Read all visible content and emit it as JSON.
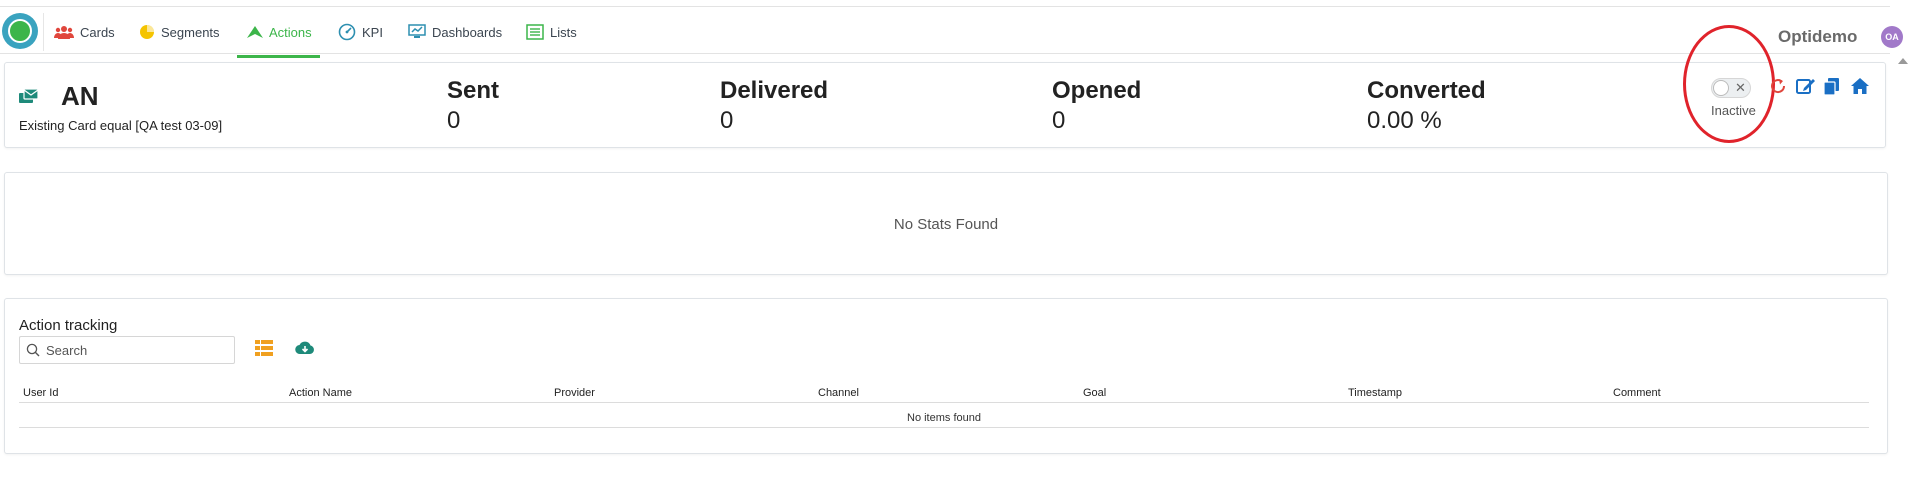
{
  "nav": {
    "items": [
      {
        "label": "Cards",
        "icon": "users-icon",
        "color": "#e0463c"
      },
      {
        "label": "Segments",
        "icon": "pie-chart-icon",
        "color": "#f5c400"
      },
      {
        "label": "Actions",
        "icon": "send-icon",
        "color": "#3cb54a"
      },
      {
        "label": "KPI",
        "icon": "gauge-icon",
        "color": "#2d8fb0"
      },
      {
        "label": "Dashboards",
        "icon": "dashboard-icon",
        "color": "#2d8fb0"
      },
      {
        "label": "Lists",
        "icon": "list-icon",
        "color": "#3cb54a"
      }
    ],
    "active": "Actions",
    "brand": "Optidemo",
    "avatar_initials": "OA"
  },
  "summary": {
    "name": "AN",
    "description": "Existing Card equal [QA test 03-09]",
    "metrics": [
      {
        "label": "Sent",
        "value": "0"
      },
      {
        "label": "Delivered",
        "value": "0"
      },
      {
        "label": "Opened",
        "value": "0"
      },
      {
        "label": "Converted",
        "value": "0.00 %"
      }
    ],
    "status_label": "Inactive",
    "status_active": false,
    "toggle_x": "✕",
    "toolbar_icons": [
      "refresh-icon",
      "edit-icon",
      "copy-icon",
      "home-icon"
    ]
  },
  "stats": {
    "empty_text": "No Stats Found"
  },
  "tracking": {
    "title": "Action tracking",
    "search_placeholder": "Search",
    "columns": [
      "User Id",
      "Action Name",
      "Provider",
      "Channel",
      "Goal",
      "Timestamp",
      "Comment"
    ],
    "empty_text": "No items found"
  },
  "colors": {
    "accent": "#3cb54a",
    "icon_blue": "#1a6fc4",
    "refresh_red": "#e0463c",
    "highlight_ring": "#e0232b",
    "grid_orange": "#f0a020",
    "teal": "#1e8a7a"
  }
}
